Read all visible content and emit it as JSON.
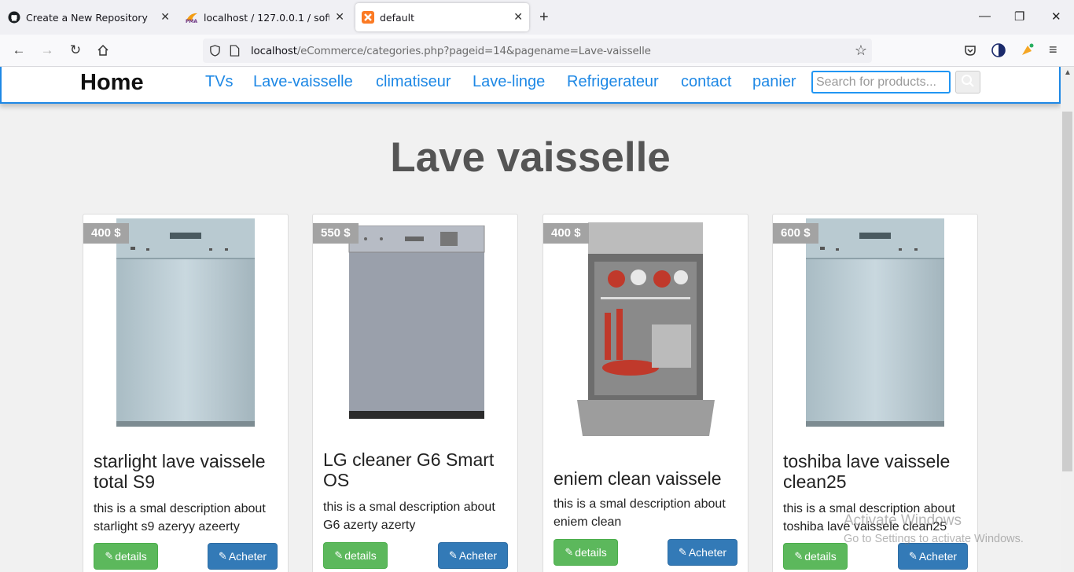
{
  "browser": {
    "tabs": [
      {
        "title": "Create a New Repository",
        "icon": "github-icon"
      },
      {
        "title": "localhost / 127.0.0.1 / softgram",
        "icon": "phpmyadmin-icon"
      },
      {
        "title": "default",
        "icon": "xampp-icon",
        "active": true
      }
    ],
    "url_host": "localhost",
    "url_path": "/eCommerce/categories.php?pageid=14&pagename=Lave-vaisselle"
  },
  "site": {
    "brand": "Home",
    "menu": [
      "TVs",
      "Lave-vaisselle",
      "climatiseur",
      "Lave-linge",
      "Refrigerateur",
      "contact",
      "panier"
    ],
    "search_placeholder": "Search for products...",
    "page_title": "Lave vaisselle"
  },
  "products": [
    {
      "price": "400 $",
      "title": "starlight lave vaissele total S9",
      "desc": "this is a smal description about starlight s9 azeryy azeerty",
      "details": "details",
      "buy": "Acheter"
    },
    {
      "price": "550 $",
      "title": "LG cleaner G6 Smart OS",
      "desc": "this is a smal description about G6 azerty azerty",
      "details": "details",
      "buy": "Acheter"
    },
    {
      "price": "400 $",
      "title": "eniem clean vaissele",
      "desc": "this is a smal description about eniem clean",
      "details": "details",
      "buy": "Acheter"
    },
    {
      "price": "600 $",
      "title": "toshiba lave vaissele clean25",
      "desc": "this is a smal description about toshiba lave vaissele clean25",
      "details": "details",
      "buy": "Acheter"
    }
  ],
  "watermark": {
    "line1": "Activate Windows",
    "line2": "Go to Settings to activate Windows."
  },
  "colors": {
    "accent": "#1e88e5",
    "green_button": "#5cb85c",
    "blue_button": "#337ab7",
    "price_badge": "#a3a3a3"
  }
}
